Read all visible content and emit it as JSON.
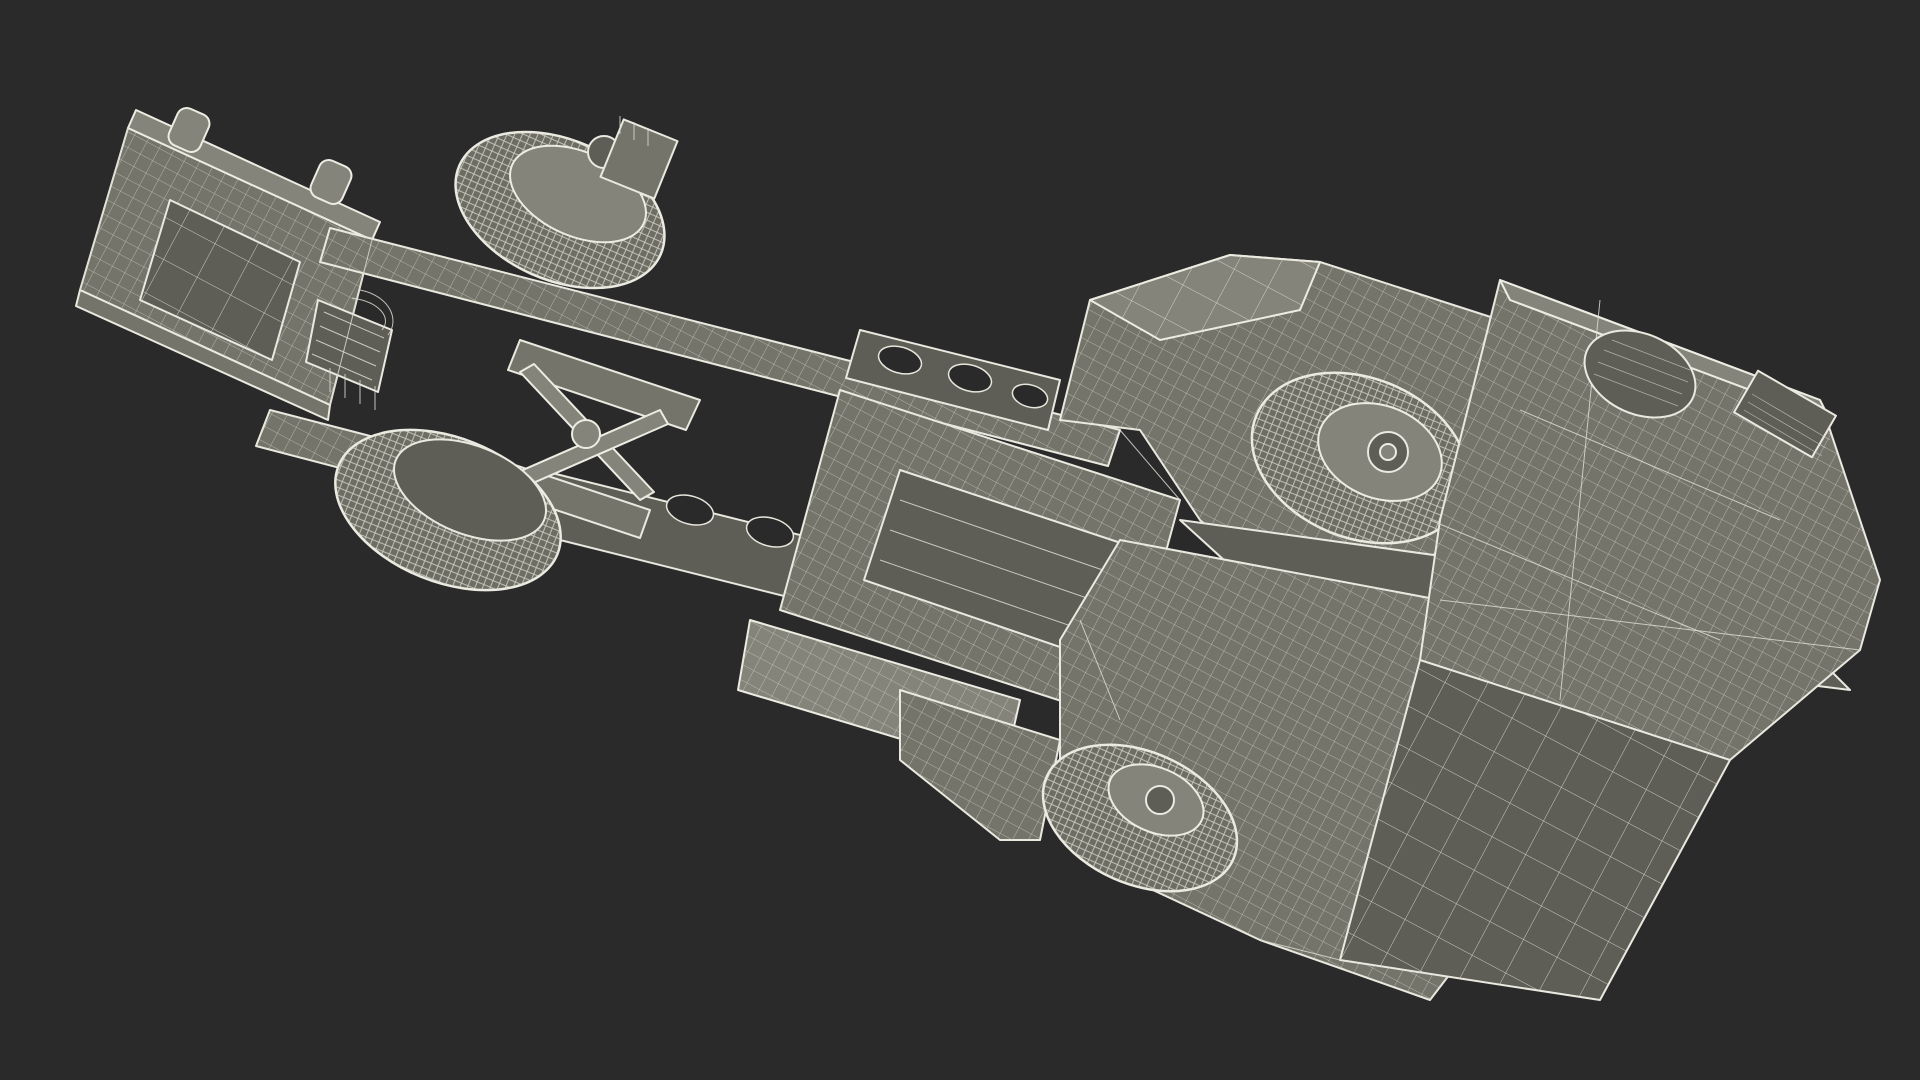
{
  "scene": {
    "subject": "truck-chassis-wireframe",
    "background_color": "#2a2a2a",
    "surface_color": "#74746a",
    "wire_color": "#e9e9e0"
  }
}
